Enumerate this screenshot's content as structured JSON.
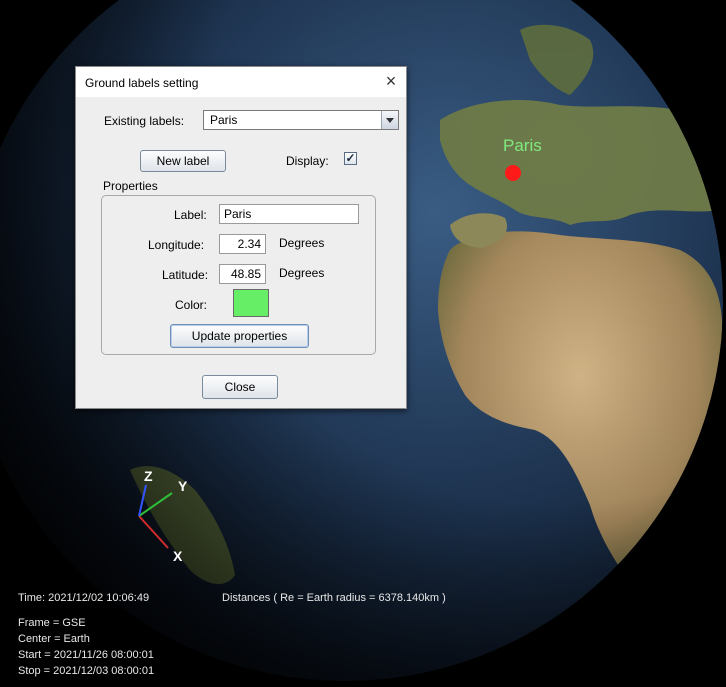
{
  "city_label": {
    "text": "Paris",
    "color": "#7fea7f",
    "marker_color": "#ff1a1a"
  },
  "axes": {
    "x": "X",
    "y": "Y",
    "z": "Z",
    "x_color": "#d22b2b",
    "y_color": "#2fbf3a",
    "z_color": "#3355ff"
  },
  "status": {
    "time": "Time: 2021/12/02 10:06:49",
    "distances": "Distances ( Re = Earth radius = 6378.140km )",
    "frame": "Frame = GSE",
    "center": "Center = Earth",
    "start": "Start = 2021/11/26 08:00:01",
    "stop": "Stop = 2021/12/03 08:00:01"
  },
  "dialog": {
    "title": "Ground labels setting",
    "existing_labels_label": "Existing labels:",
    "existing_labels_value": "Paris",
    "new_label_button": "New label",
    "display_label": "Display:",
    "display_checked": true,
    "properties_title": "Properties",
    "label_label": "Label:",
    "label_value": "Paris",
    "longitude_label": "Longitude:",
    "longitude_value": "2.34",
    "longitude_unit": "Degrees",
    "latitude_label": "Latitude:",
    "latitude_value": "48.85",
    "latitude_unit": "Degrees",
    "color_label": "Color:",
    "color_value": "#66ee66",
    "update_button": "Update properties",
    "close_button": "Close",
    "check_glyph": "✓",
    "close_glyph": "×"
  }
}
